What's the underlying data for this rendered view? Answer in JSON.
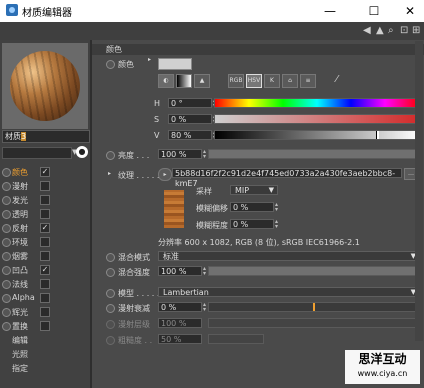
{
  "window": {
    "title": "材质编辑器",
    "minimize": "—",
    "maximize": "☐",
    "close": "✕"
  },
  "material": {
    "name_prefix": "材质",
    "name_sel": "3"
  },
  "channels": [
    {
      "label": "颜色",
      "checked": true,
      "selected": true
    },
    {
      "label": "漫射",
      "checked": false
    },
    {
      "label": "发光",
      "checked": false
    },
    {
      "label": "透明",
      "checked": false
    },
    {
      "label": "反射",
      "checked": true
    },
    {
      "label": "环境",
      "checked": false
    },
    {
      "label": "烟雾",
      "checked": false
    },
    {
      "label": "凹凸",
      "checked": true
    },
    {
      "label": "法线",
      "checked": false
    },
    {
      "label": "Alpha",
      "checked": false
    },
    {
      "label": "辉光",
      "checked": false
    },
    {
      "label": "置换",
      "checked": false
    }
  ],
  "extra_items": [
    "编辑",
    "光照",
    "指定"
  ],
  "color_section": {
    "header": "颜色",
    "label": "颜色",
    "mode_buttons": [
      "RGB",
      "HSV",
      "K",
      "⌂",
      "≡"
    ],
    "H": {
      "label": "H",
      "value": "0 °"
    },
    "S": {
      "label": "S",
      "value": "0 %"
    },
    "V": {
      "label": "V",
      "value": "80 %",
      "fraction": 0.8
    }
  },
  "brightness": {
    "label": "亮度 . . .",
    "value": "100 %",
    "fraction": 1.0
  },
  "texture": {
    "label": "纹理 . . . . . . .",
    "filename": "5b88d16f2f2c91d2e4f745ed0733a2a430fe3aeb2bbc8-kmE7",
    "sampling_label": "采样",
    "sampling_value": "MIP",
    "blur_offset_label": "模糊偏移",
    "blur_offset_value": "0 %",
    "blur_scale_label": "模糊程度",
    "blur_scale_value": "0 %",
    "info": "分辨率 600 x 1082, RGB (8 位), sRGB IEC61966-2.1"
  },
  "mix": {
    "mode_label": "混合模式",
    "mode_value": "标准",
    "strength_label": "混合强度",
    "strength_value": "100 %",
    "strength_fraction": 1.0
  },
  "model": {
    "label": "模型 . . . . .",
    "value": "Lambertian",
    "diffuse_falloff_label": "漫射衰减",
    "diffuse_falloff_value": "0 %",
    "diffuse_level_label": "漫射层级",
    "diffuse_level_value": "100 %",
    "roughness_label": "粗糙度 . .",
    "roughness_value": "50 %"
  },
  "watermark": {
    "line1": "思洋互动",
    "line2": "www.ciya.cn"
  }
}
